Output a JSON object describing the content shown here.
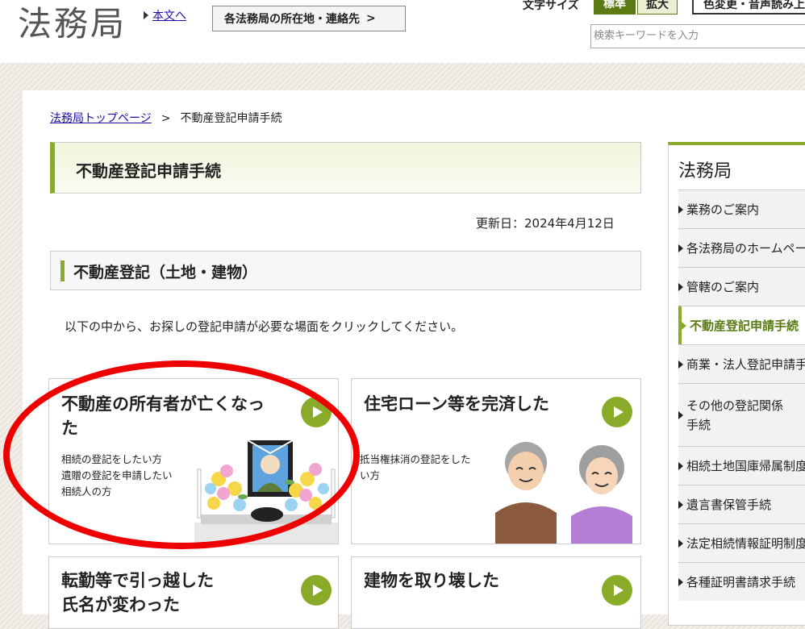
{
  "header": {
    "logo": "法務局",
    "skip_link": "本文へ",
    "offices_button": "各法務局の所在地・連絡先",
    "font_size_label": "文字サイズ",
    "font_standard": "標準",
    "font_large": "拡大",
    "color_button": "色変更・音声読み上げ",
    "search_placeholder": "検索キーワードを入力"
  },
  "breadcrumb": {
    "home": "法務局トップページ",
    "separator": ">",
    "current": "不動産登記申請手続"
  },
  "page_title": "不動産登記申請手続",
  "updated": "更新日：2024年4月12日",
  "section_title": "不動産登記（土地・建物）",
  "intro": "以下の中から、お探しの登記申請が必要な場面をクリックしてください。",
  "cards": [
    {
      "title_line1": "不動産の所有者が亡くなっ",
      "title_line2": "た",
      "desc": [
        "相続の登記をしたい方",
        "遺贈の登記を申請したい",
        "相続人の方"
      ]
    },
    {
      "title_line1": "住宅ローン等を完済した",
      "desc": [
        "抵当権抹消の登記をした",
        "い方"
      ]
    },
    {
      "title_line1": "転勤等で引っ越した",
      "title_line2": "氏名が変わった"
    },
    {
      "title_line1": "建物を取り壊した"
    }
  ],
  "sidebar": {
    "title": "法務局",
    "items": [
      {
        "label": "業務のご案内"
      },
      {
        "label": "各法務局のホームページ"
      },
      {
        "label": "管轄のご案内"
      },
      {
        "label": "不動産登記申請手続",
        "active": true
      },
      {
        "label": "商業・法人登記申請手続"
      },
      {
        "label_line1": "その他の登記関係",
        "label_line2": "手続"
      },
      {
        "label": "相続土地国庫帰属制度"
      },
      {
        "label": "遺言書保管手続"
      },
      {
        "label": "法定相続情報証明制度"
      },
      {
        "label": "各種証明書請求手続"
      }
    ]
  },
  "colors": {
    "accent": "#8aab2a",
    "accent_dark": "#5b7a14",
    "highlight_ring": "#e00000"
  }
}
